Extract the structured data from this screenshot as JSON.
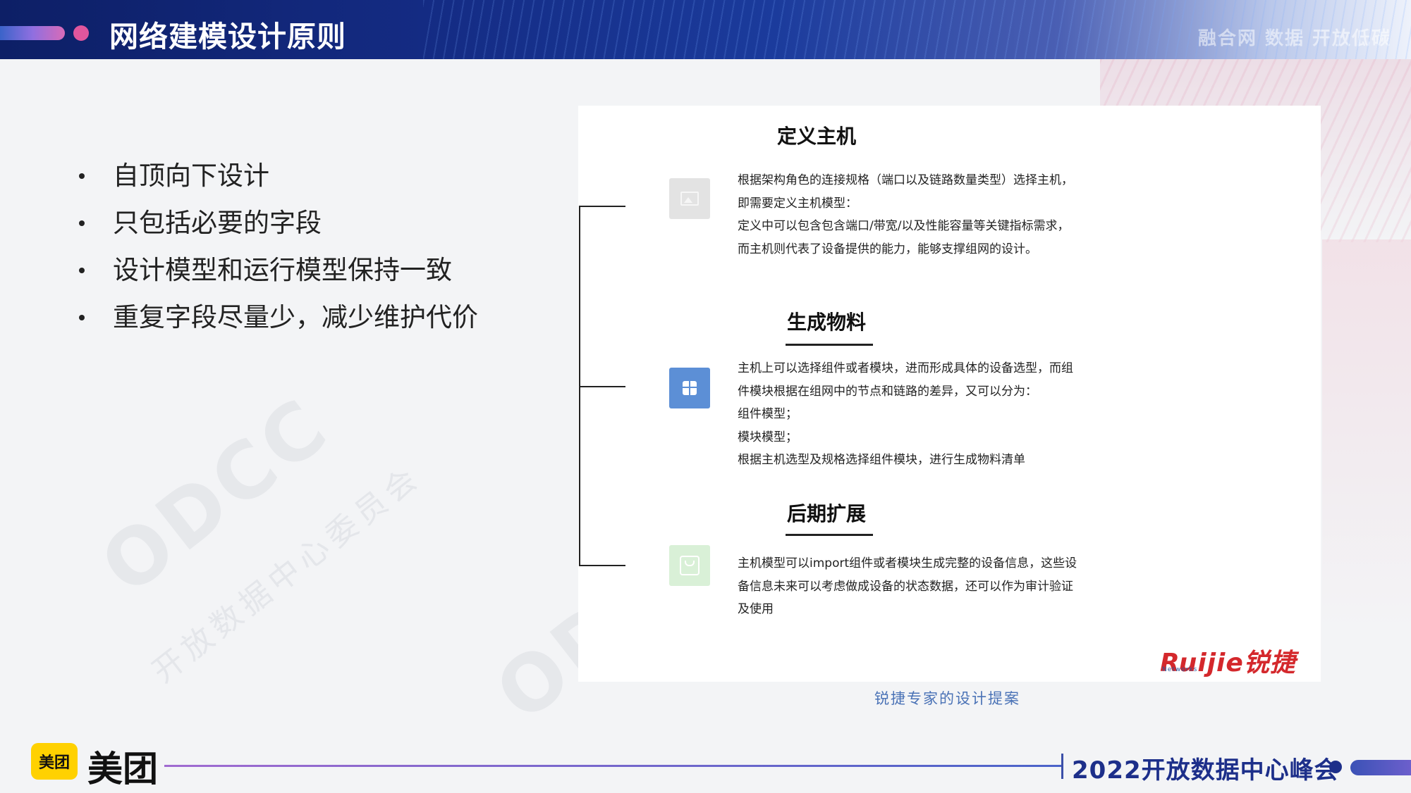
{
  "header": {
    "title": "网络建模设计原则",
    "slogan": "融合网  数据  开放低碳  "
  },
  "watermark": {
    "brand": "ODCC",
    "text": "开放数据中心委员会"
  },
  "bullets": [
    "自顶向下设计",
    "只包括必要的字段",
    "设计模型和运行模型保持一致",
    "重复字段尽量少，减少维护代价"
  ],
  "figure": {
    "sections": [
      {
        "title": "定义主机",
        "icon": "image-icon",
        "body": "根据架构角色的连接规格（端口以及链路数量类型）选择主机，\n即需要定义主机模型：\n定义中可以包含包含端口/带宽/以及性能容量等关键指标需求，\n而主机则代表了设备提供的能力，能够支撑组网的设计。"
      },
      {
        "title": "生成物料",
        "icon": "box-icon",
        "body": "主机上可以选择组件或者模块，进而形成具体的设备选型，而组\n件模块根据在组网中的节点和链路的差异，又可以分为：\n组件模型；\n模块模型；\n根据主机选型及规格选择组件模块，进行生成物料清单"
      },
      {
        "title": "后期扩展",
        "icon": "bag-icon",
        "body": "主机模型可以import组件或者模块生成完整的设备信息，这些设\n备信息未来可以考虑做成设备的状态数据，还可以作为审计验证\n及使用"
      }
    ],
    "logo": "Ruijie锐捷",
    "logo_sub": "Networks",
    "caption": "锐捷专家的设计提案"
  },
  "footer": {
    "badge": "美团",
    "brand": "美团",
    "event": "2022开放数据中心峰会"
  },
  "colors": {
    "header_bg": "#142b83",
    "accent_pink": "#e0569d",
    "caption_blue": "#4a72b6",
    "ruijie_red": "#d4282c",
    "meituan_yellow": "#ffd100"
  }
}
